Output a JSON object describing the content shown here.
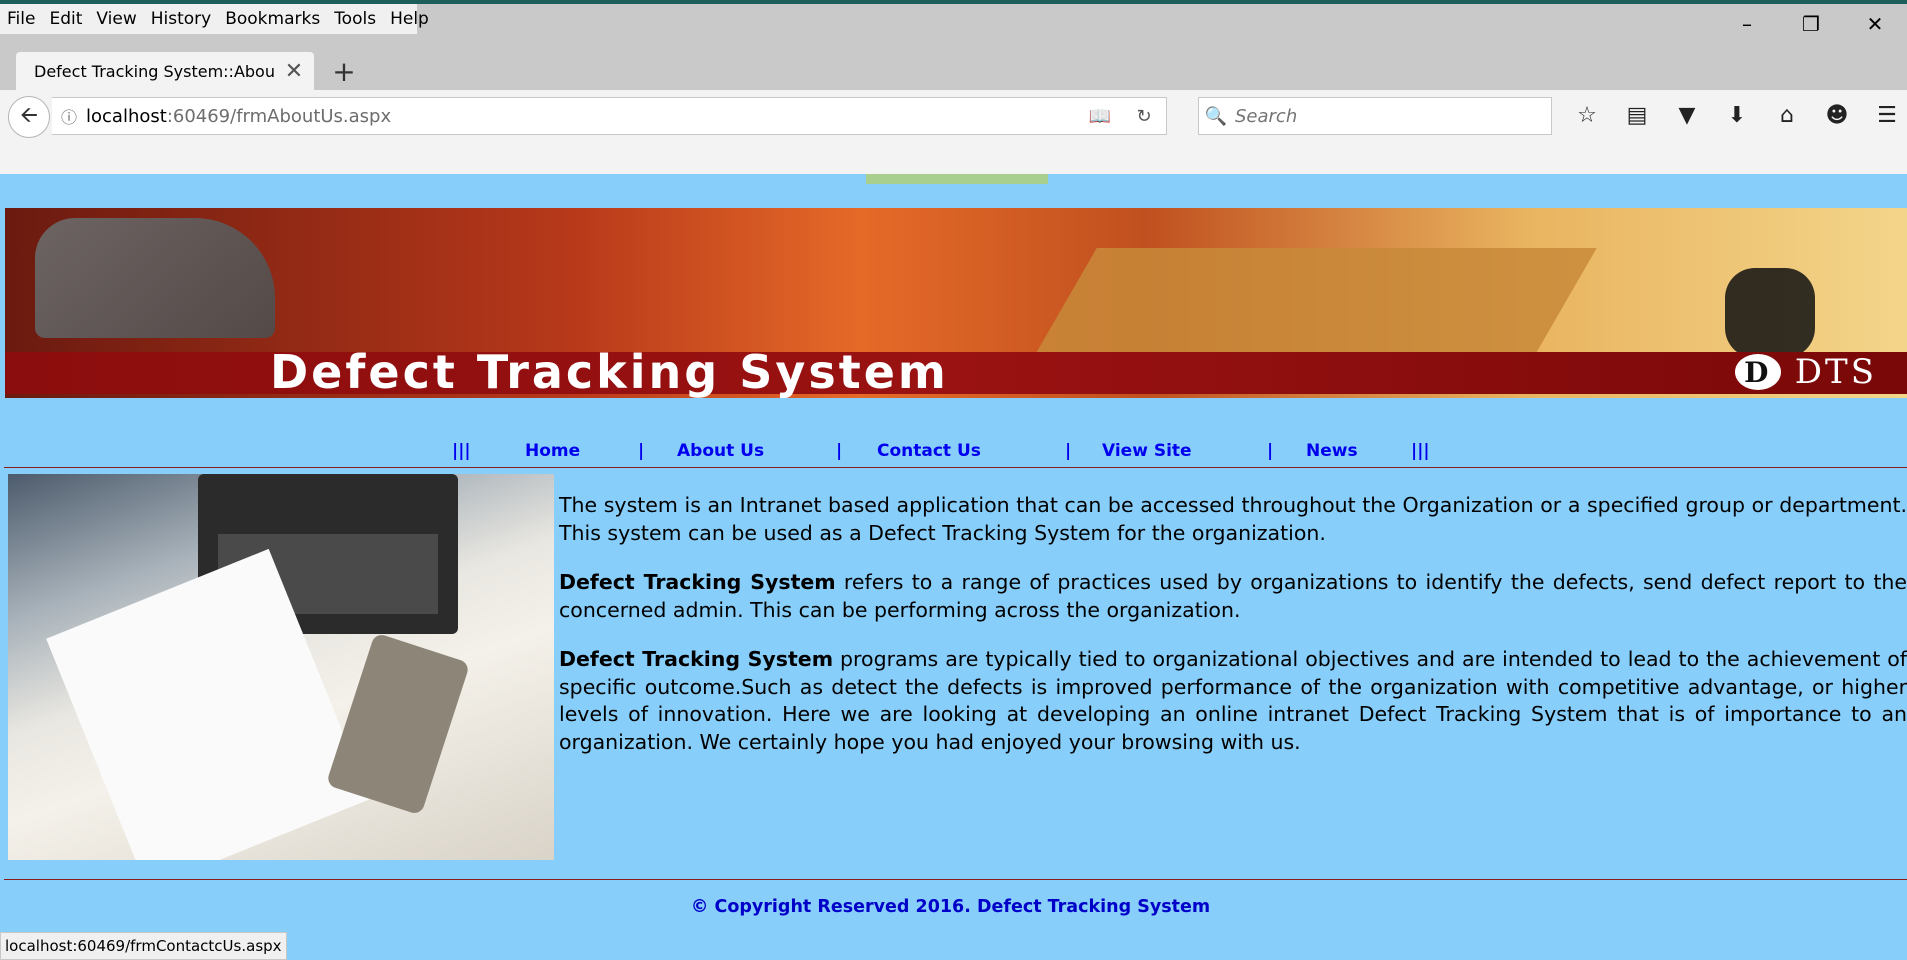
{
  "browser": {
    "menu": [
      "File",
      "Edit",
      "View",
      "History",
      "Bookmarks",
      "Tools",
      "Help"
    ],
    "window_controls": {
      "minimize": "–",
      "restore": "❐",
      "close": "✕"
    },
    "tab": {
      "title": "Defect Tracking System::Abou...",
      "close": "✕"
    },
    "new_tab": "+",
    "url": {
      "host": "localhost",
      "path": ":60469/frmAboutUs.aspx"
    },
    "search_placeholder": "Search",
    "status_url": "localhost:60469/frmContactcUs.aspx"
  },
  "site": {
    "banner_title": "Defect Tracking System",
    "banner_logo_letter": "D",
    "banner_logo_text": "DTS",
    "nav": {
      "sep_start": "|||",
      "sep_end": "|||",
      "sep": "|",
      "items": [
        "Home",
        "About Us",
        "Contact Us",
        "View Site",
        "News"
      ]
    },
    "content": {
      "p1": "The system is an Intranet based application that can be accessed throughout the Organization or a specified group or department. This system can be used as a Defect Tracking System for the organization.",
      "p2_bold": "Defect Tracking System",
      "p2_rest": " refers to a range of practices used by organizations to identify the defects, send defect report to the concerned admin. This can be performing across the organization.",
      "p3_bold": "Defect Tracking System",
      "p3_rest": " programs are typically tied to organizational objectives and are intended to lead to the achievement of specific outcome.Such as detect the defects is improved performance of the organization with competitive advantage, or higher levels of innovation. Here we are looking at developing an online intranet Defect Tracking System that is of importance to an organization. We certainly hope you had enjoyed your browsing with us."
    },
    "copyright": "© Copyright Reserved 2016. Defect Tracking System"
  }
}
